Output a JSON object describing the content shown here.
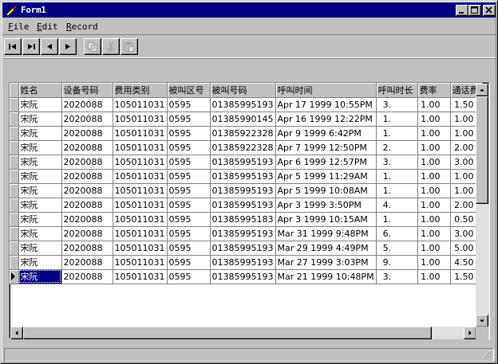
{
  "window": {
    "title": "Form1",
    "icon": "pen-icon"
  },
  "menu": [
    {
      "label": "File",
      "underline": "F",
      "rest": "ile"
    },
    {
      "label": "Edit",
      "underline": "E",
      "rest": "dit"
    },
    {
      "label": "Record",
      "underline": "R",
      "rest": "ecord"
    }
  ],
  "toolbar": {
    "buttons": [
      "first-record-icon",
      "last-record-icon",
      "previous-record-icon",
      "next-record-icon",
      "copy-icon",
      "cut-icon",
      "paste-icon"
    ]
  },
  "grid": {
    "columns": [
      "姓名",
      "设备号码",
      "费用类别",
      "被叫区号",
      "被叫号码",
      "呼叫时间",
      "呼叫时长",
      "费率",
      "通话费"
    ],
    "rows": [
      [
        "宋阮",
        "2020088",
        "105011031",
        "0595",
        "01385995193",
        "Apr 17 1999 10:55PM",
        "3.",
        "1.00",
        "1.50"
      ],
      [
        "宋阮",
        "2020088",
        "105011031",
        "0595",
        "01385990145",
        "Apr 16 1999 12:22PM",
        "1.",
        "1.00",
        "1.00"
      ],
      [
        "宋阮",
        "2020088",
        "105011031",
        "0595",
        "01385922328",
        "Apr  9 1999  6:42PM",
        "1.",
        "1.00",
        "1.00"
      ],
      [
        "宋阮",
        "2020088",
        "105011031",
        "0595",
        "01385922328",
        "Apr  7 1999 12:50PM",
        "2.",
        "1.00",
        "2.00"
      ],
      [
        "宋阮",
        "2020088",
        "105011031",
        "0595",
        "01385995193",
        "Apr  6 1999 12:57PM",
        "3.",
        "1.00",
        "3.00"
      ],
      [
        "宋阮",
        "2020088",
        "105011031",
        "0595",
        "01385995193",
        "Apr  5 1999 11:29AM",
        "1.",
        "1.00",
        "1.00"
      ],
      [
        "宋阮",
        "2020088",
        "105011031",
        "0595",
        "01385995193",
        "Apr  5 1999 10:08AM",
        "1.",
        "1.00",
        "1.00"
      ],
      [
        "宋阮",
        "2020088",
        "105011031",
        "0595",
        "01385995193",
        "Apr  3 1999  3:50PM",
        "4.",
        "1.00",
        "2.00"
      ],
      [
        "宋阮",
        "2020088",
        "105011031",
        "0595",
        "01385995183",
        "Apr  3 1999 10:15AM",
        "1.",
        "1.00",
        "0.50"
      ],
      [
        "宋阮",
        "2020088",
        "105011031",
        "0595",
        "01385995193",
        "Mar 31 1999  9:48PM",
        "6.",
        "1.00",
        "3.00"
      ],
      [
        "宋阮",
        "2020088",
        "105011031",
        "0595",
        "01385995193",
        "Mar 29 1999  4:49PM",
        "5.",
        "1.00",
        "5.00"
      ],
      [
        "宋阮",
        "2020088",
        "105011031",
        "0595",
        "01385995193",
        "Mar 27 1999  3:03PM",
        "9.",
        "1.00",
        "4.50"
      ],
      [
        "宋阮",
        "2020088",
        "105011031",
        "0595",
        "01385995193",
        "Mar 21 1999 10:48PM",
        "3.",
        "1.00",
        "1.50"
      ]
    ],
    "current_row": 12
  },
  "colors": {
    "titlebar": "#000080",
    "selection": "#000080",
    "face": "#c0c0c0"
  }
}
